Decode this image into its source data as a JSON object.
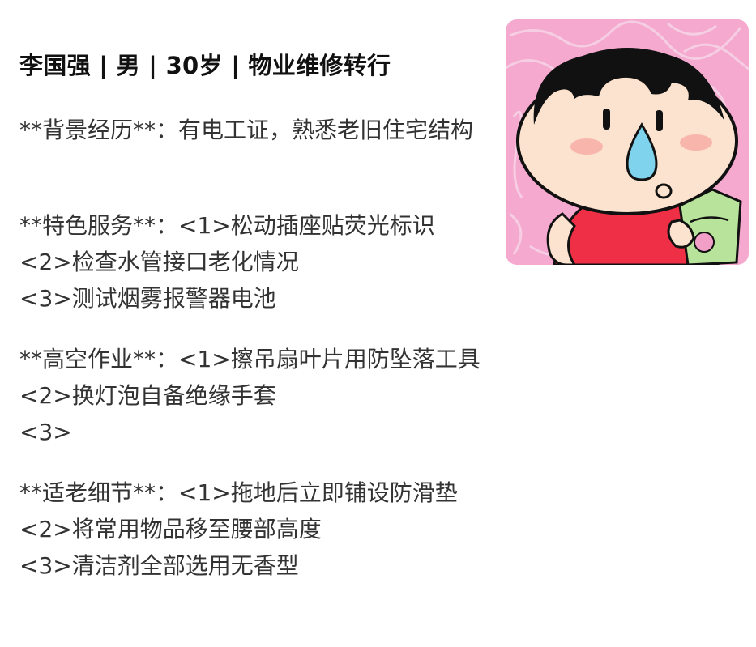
{
  "profile": {
    "header": "李国强 | 男 | 30岁 | 物业维修转行",
    "background": "**背景经历**：有电工证，熟悉老旧住宅结构"
  },
  "sections": [
    {
      "lines": [
        "**特色服务**：<1>松动插座贴荧光标识",
        "<2>检查水管接口老化情况",
        "<3>测试烟雾报警器电池"
      ]
    },
    {
      "lines": [
        "**高空作业**：<1>擦吊扇叶片用防坠落工具",
        "<2>换灯泡自备绝缘手套",
        "<3>"
      ]
    },
    {
      "lines": [
        "**适老细节**：<1>拖地后立即铺设防滑垫",
        "<2>将常用物品移至腰部高度",
        "<3>清洁剂全部选用无香型"
      ]
    }
  ],
  "avatar": {
    "icon": "cartoon-avatar-icon",
    "colors": {
      "background": "#f5a9cf",
      "scribble": "#f7d2e6",
      "hair": "#111111",
      "skin": "#fbe3cf",
      "shirt": "#ee2f45",
      "tear": "#7fd3ec",
      "cheek": "#f7a9a3",
      "carton": "#b8e39a"
    }
  }
}
